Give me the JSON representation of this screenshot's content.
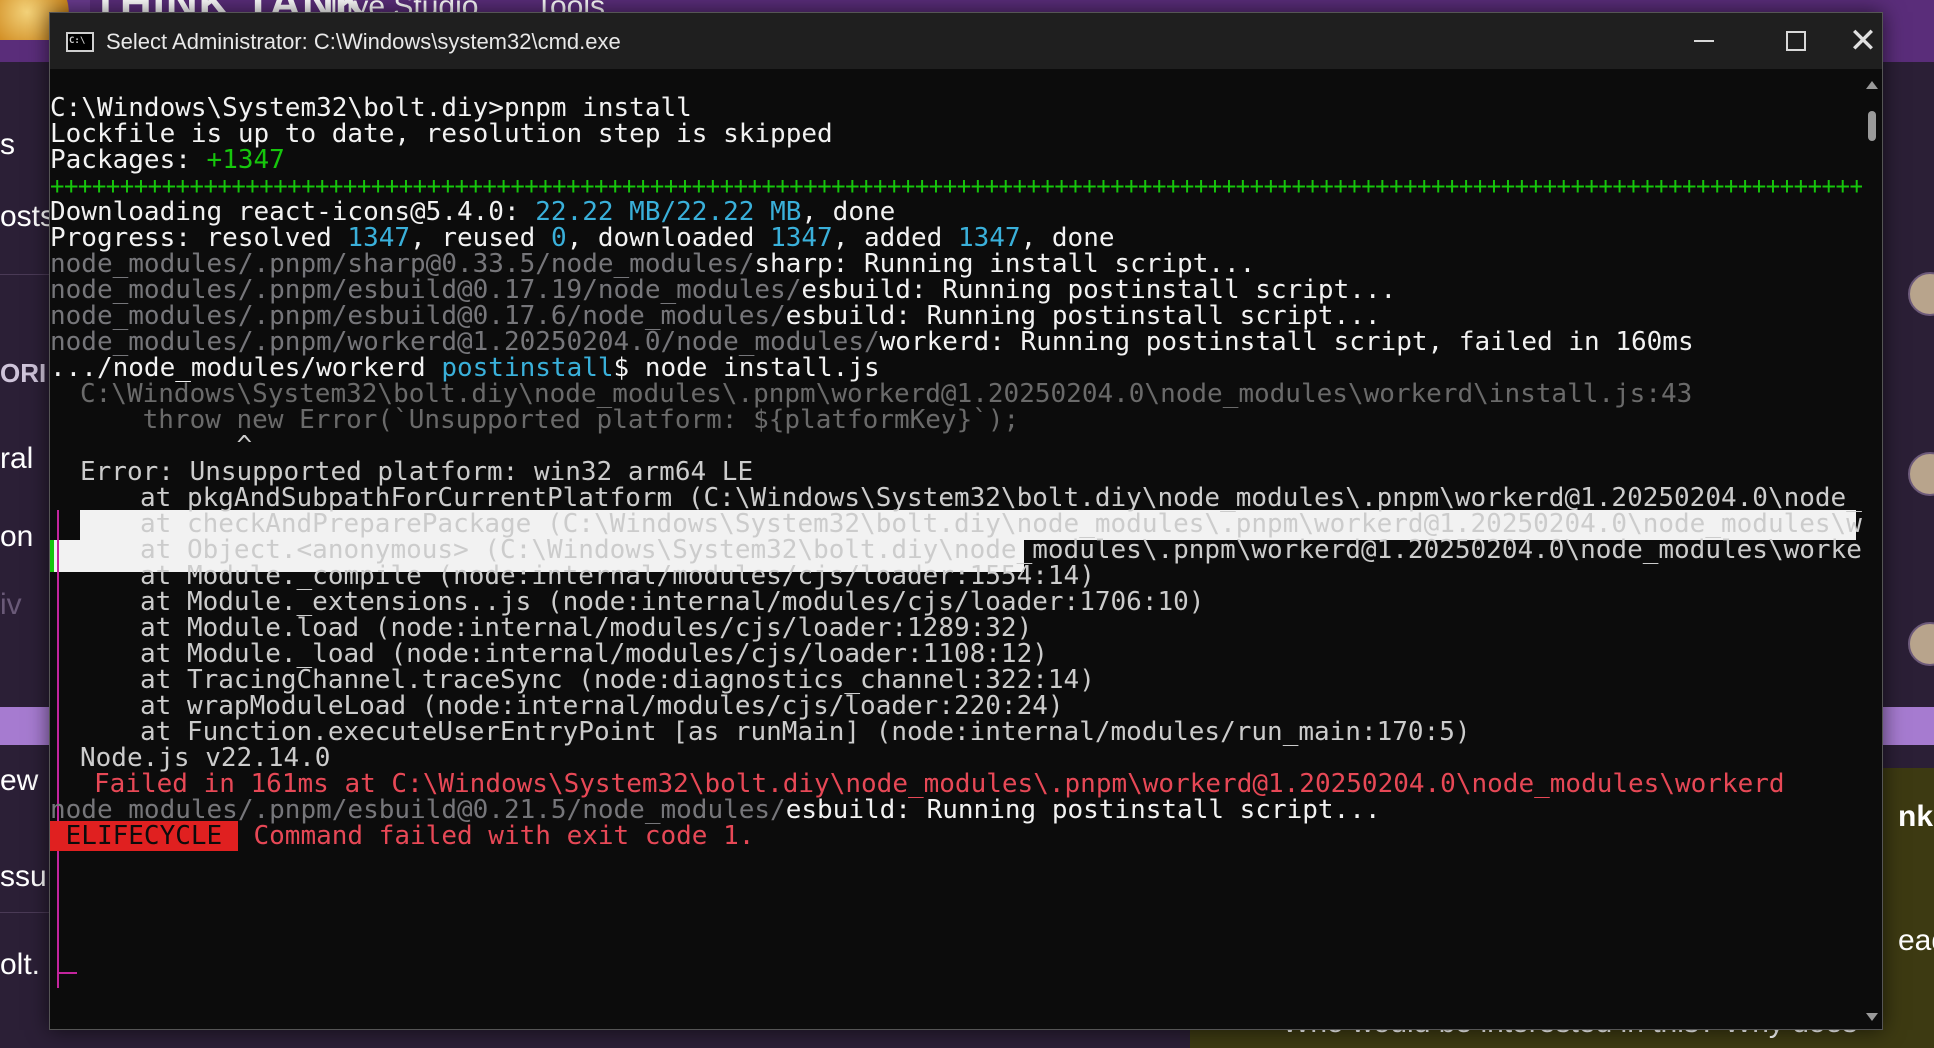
{
  "background_page": {
    "brand": "THINK TANK",
    "nav": [
      "Live Studio",
      "Tools"
    ],
    "left_fragments": [
      "s",
      "osts",
      "ORI",
      "ral",
      "on",
      "iv",
      "ew",
      "ssu",
      "olt."
    ],
    "right_fragments": [
      "nks",
      "ead"
    ],
    "bottom_text": "Who would be interested in this? Why does"
  },
  "window": {
    "title": "Select Administrator:  C:\\Windows\\system32\\cmd.exe",
    "minimize_label": "",
    "maximize_label": "",
    "close_label": "✕"
  },
  "terminal": {
    "l1": "C:\\Windows\\System32\\bolt.diy>pnpm install",
    "l2": "Lockfile is up to date, resolution step is skipped",
    "l3a": "Packages: ",
    "l3b": "+1347",
    "l4": "++++++++++++++++++++++++++++++++++++++++++++++++++++++++++++++++++++++++++++++++++++++++++++++++++++++++++++++++++++++++++++++++++++++++++++++++++++++++++++++++++++++++++++++++++++++++++++++++++++++++",
    "l5a": "Downloading react-icons@5.4.0: ",
    "l5b": "22.22 MB/22.22 MB",
    "l5c": ", done",
    "l6a": "Progress: resolved ",
    "l6b": "1347",
    "l6c": ", reused ",
    "l6d": "0",
    "l6e": ", downloaded ",
    "l6f": "1347",
    "l6g": ", added ",
    "l6h": "1347",
    "l6i": ", done",
    "l7a": "node_modules/.pnpm/sharp@0.33.5/node_modules/",
    "l7b": "sharp: Running install script...",
    "l8a": "node_modules/.pnpm/esbuild@0.17.19/node_modules/",
    "l8b": "esbuild: Running postinstall script...",
    "l9a": "node_modules/.pnpm/esbuild@0.17.6/node_modules/",
    "l9b": "esbuild: Running postinstall script...",
    "l10a": "node_modules/.pnpm/workerd@1.20250204.0/node_modules/",
    "l10b": "workerd: Running postinstall script, failed in 160ms",
    "l11a": ".../node_modules/workerd ",
    "l11b": "postinstall",
    "l11c": "$ node install.js",
    "l12": "C:\\Windows\\System32\\bolt.diy\\node_modules\\.pnpm\\workerd@1.20250204.0\\node_modules\\workerd\\install.js:43",
    "l13": "    throw new Error(`Unsupported platform: ${platformKey}`);",
    "l14": "          ^",
    "l15": "Error: Unsupported platform: win32 arm64 LE",
    "l16": "at pkgAndSubpathForCurrentPlatform (C:\\Windows\\System32\\bolt.diy\\node_modules\\.pnpm\\workerd@1.20250204.0\\node_m…",
    "l17": "at checkAndPreparePackage (C:\\Windows\\System32\\bolt.diy\\node_modules\\.pnpm\\workerd@1.20250204.0\\node_modules\\wo…",
    "l18": "at Object.<anonymous> (C:\\Windows\\System32\\bolt.diy\\node_modules\\.pnpm\\workerd@1.20250204.0\\node_modules\\worker…",
    "l19": "at Module._compile (node:internal/modules/cjs/loader:1554:14)",
    "l20": "at Module._extensions..js (node:internal/modules/cjs/loader:1706:10)",
    "l21": "at Module.load (node:internal/modules/cjs/loader:1289:32)",
    "l22": "at Module._load (node:internal/modules/cjs/loader:1108:12)",
    "l23": "at TracingChannel.traceSync (node:diagnostics_channel:322:14)",
    "l24": "at wrapModuleLoad (node:internal/modules/cjs/loader:220:24)",
    "l25": "at Function.executeUserEntryPoint [as runMain] (node:internal/modules/run_main:170:5)",
    "l26": "Node.js v22.14.0",
    "l27": "Failed in 161ms at C:\\Windows\\System32\\bolt.diy\\node_modules\\.pnpm\\workerd@1.20250204.0\\node_modules\\workerd",
    "l28a": "node_modules/.pnpm/esbuild@0.21.5/node_modules/",
    "l28b": "esbuild: Running postinstall script...",
    "l29a": " ELIFECYCLE ",
    "l29b": " Command failed with exit code 1."
  },
  "colors": {
    "terminal_bg": "#0c0c0c",
    "text": "#cccccc",
    "dim": "#76767a",
    "cyan": "#3ab0da",
    "green": "#16c60c",
    "red": "#e74856",
    "magenta": "#c3259d"
  }
}
